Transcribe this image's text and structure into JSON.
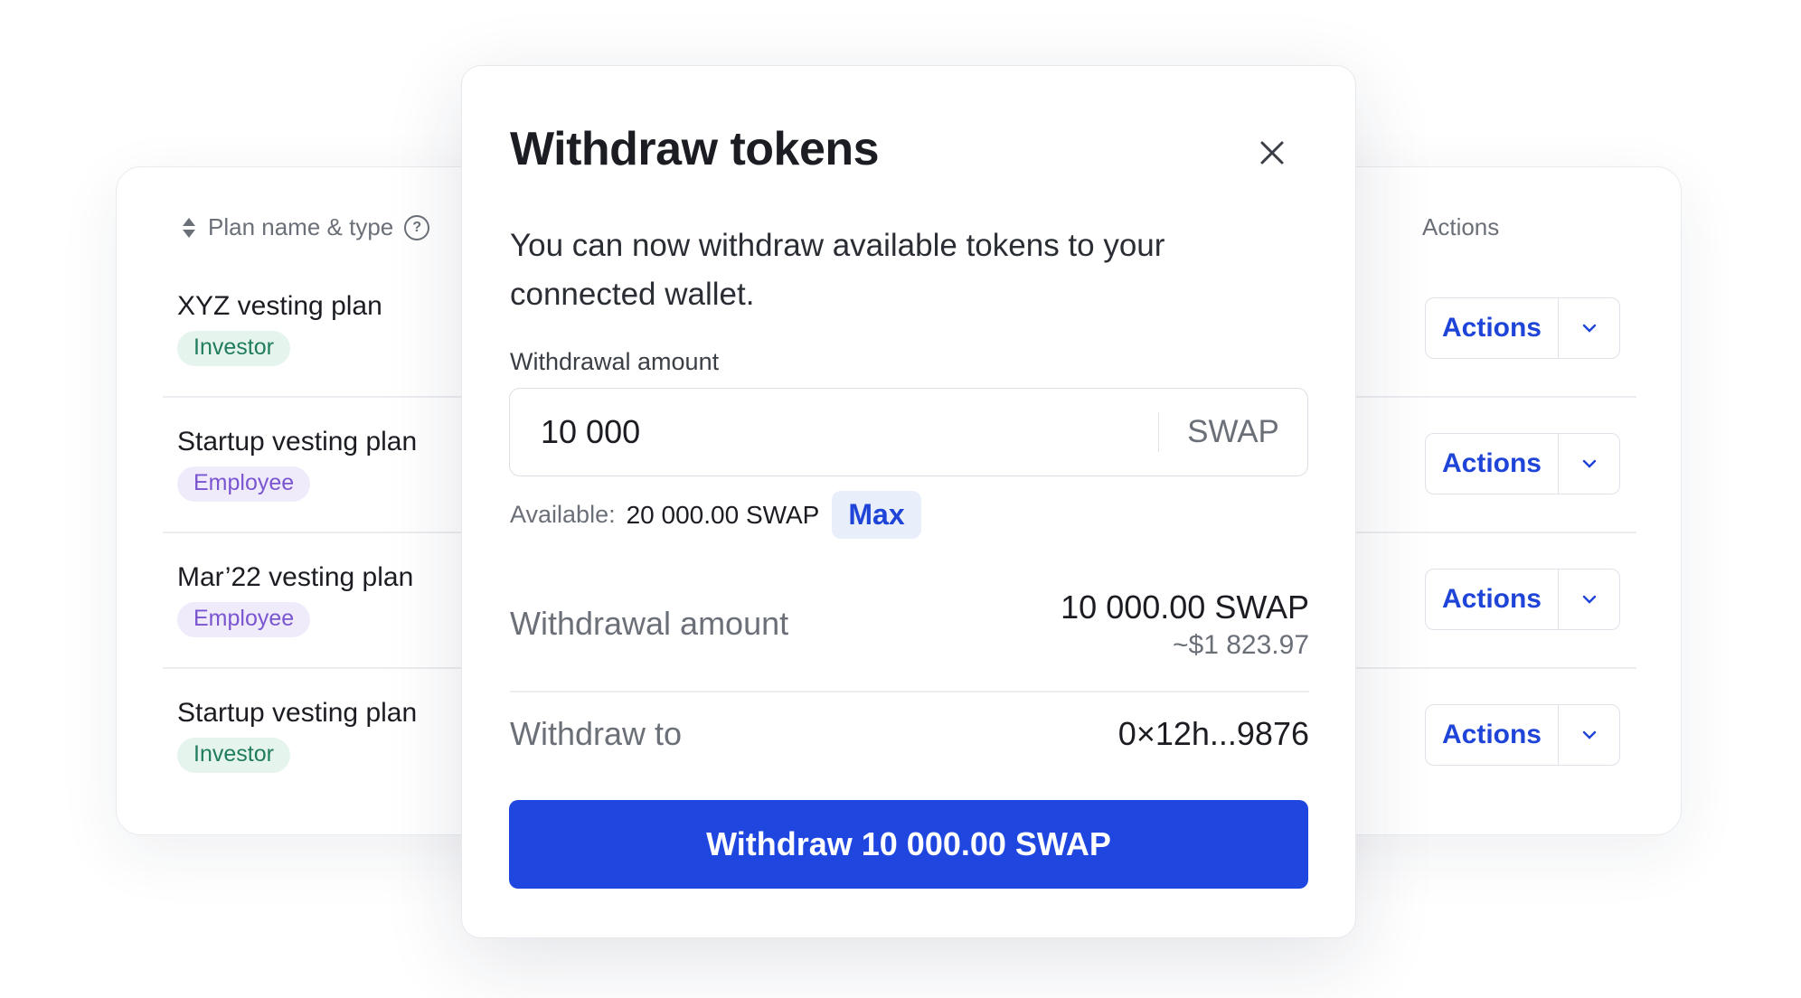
{
  "table": {
    "plan_header": "Plan name & type",
    "actions_header": "Actions",
    "rows": [
      {
        "name": "XYZ vesting plan",
        "type": "Investor",
        "action_label": "Actions"
      },
      {
        "name": "Startup vesting plan",
        "type": "Employee",
        "action_label": "Actions"
      },
      {
        "name": "Mar’22 vesting plan",
        "type": "Employee",
        "action_label": "Actions"
      },
      {
        "name": "Startup vesting plan",
        "type": "Investor",
        "action_label": "Actions"
      }
    ]
  },
  "modal": {
    "title": "Withdraw tokens",
    "description": "You can now withdraw available tokens to your connected wallet.",
    "amount_label": "Withdrawal amount",
    "amount_value": "10 000",
    "amount_unit": "SWAP",
    "available_label": "Available:",
    "available_value": "20 000.00 SWAP",
    "max_label": "Max",
    "summary": {
      "amount_key": "Withdrawal amount",
      "amount_value": "10 000.00 SWAP",
      "amount_usd": "~$1 823.97",
      "to_key": "Withdraw to",
      "to_value": "0×12h...9876"
    },
    "submit_label": "Withdraw 10 000.00 SWAP"
  },
  "colors": {
    "accent": "#1f47e0",
    "link": "#1f44d8",
    "investor_badge_bg": "#e6f4ee",
    "investor_badge_text": "#1f7c5c",
    "employee_badge_bg": "#efebfb",
    "employee_badge_text": "#7a55d0"
  },
  "icons": {
    "sort": "sort-icon",
    "help": "help-icon",
    "close": "close-icon",
    "chevron": "chevron-down-icon"
  }
}
